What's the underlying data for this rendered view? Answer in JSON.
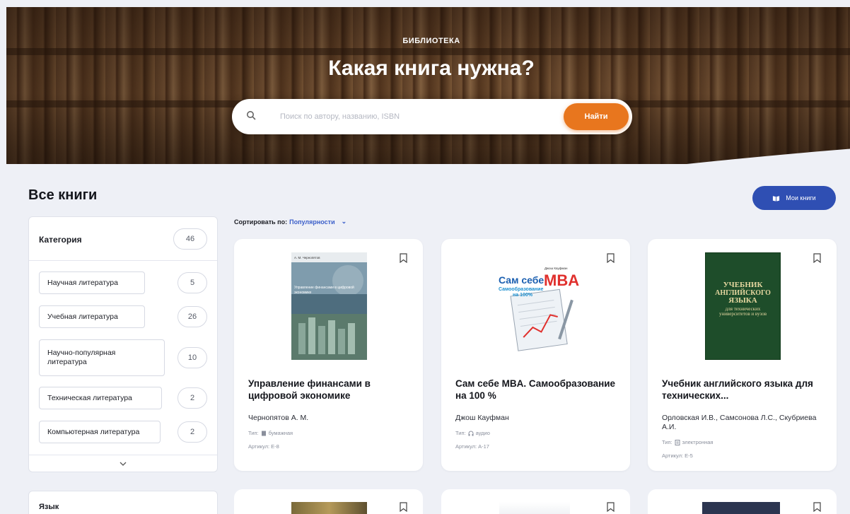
{
  "hero": {
    "kicker": "БИБЛИОТЕКА",
    "title": "Какая книга нужна?",
    "search_placeholder": "Поиск по автору, названию, ISBN",
    "search_button": "Найти"
  },
  "page": {
    "title": "Все книги",
    "my_books_label": "Мои книги"
  },
  "filter": {
    "title": "Категория",
    "total": "46",
    "categories": [
      {
        "label": "Научная литература",
        "count": "5"
      },
      {
        "label": "Учебная литература",
        "count": "26"
      },
      {
        "label": "Научно-популярная литература",
        "count": "10"
      },
      {
        "label": "Техническая литература",
        "count": "2"
      },
      {
        "label": "Компьютерная литература",
        "count": "2"
      }
    ],
    "second_title": "Язык"
  },
  "sort": {
    "label": "Сортировать по:",
    "value": "Популярности"
  },
  "books": [
    {
      "title": "Управление финансами в цифровой экономике",
      "author": "Чернопятов А. М.",
      "type_label": "Тип:",
      "type": "бумажная",
      "type_icon": "book-icon",
      "article_label": "Артикул:",
      "article": "Е-8",
      "cover_caption": "Управление финансами в цифровой экономике",
      "cover_author": "А. М. Чернопятов"
    },
    {
      "title": "Сам себе MBA. Самообразование на 100 %",
      "author": "Джош Кауфман",
      "type_label": "Тип:",
      "type": "аудио",
      "type_icon": "headphones-icon",
      "article_label": "Артикул:",
      "article": "А-17",
      "cover_line1": "Сам себе",
      "cover_line2": "MBA",
      "cover_line3": "Самообразование",
      "cover_line4": "на 100%",
      "cover_author": "Джош Кауфман"
    },
    {
      "title": "Учебник английского языка для технических...",
      "author": "Орловская И.В., Самсонова Л.С., Скубриева А.И.",
      "type_label": "Тип:",
      "type": "электронная",
      "type_icon": "ebook-icon",
      "article_label": "Артикул:",
      "article": "Е-5",
      "cover_line1": "УЧЕБНИК",
      "cover_line2": "АНГЛИЙСКОГО",
      "cover_line3": "ЯЗЫКА",
      "cover_line4": "для технических университетов и вузов"
    }
  ],
  "colors": {
    "accent_orange": "#e8761e",
    "brand_blue": "#2f4fb3",
    "link_blue": "#3a5ec9",
    "background": "#eef0f6"
  }
}
